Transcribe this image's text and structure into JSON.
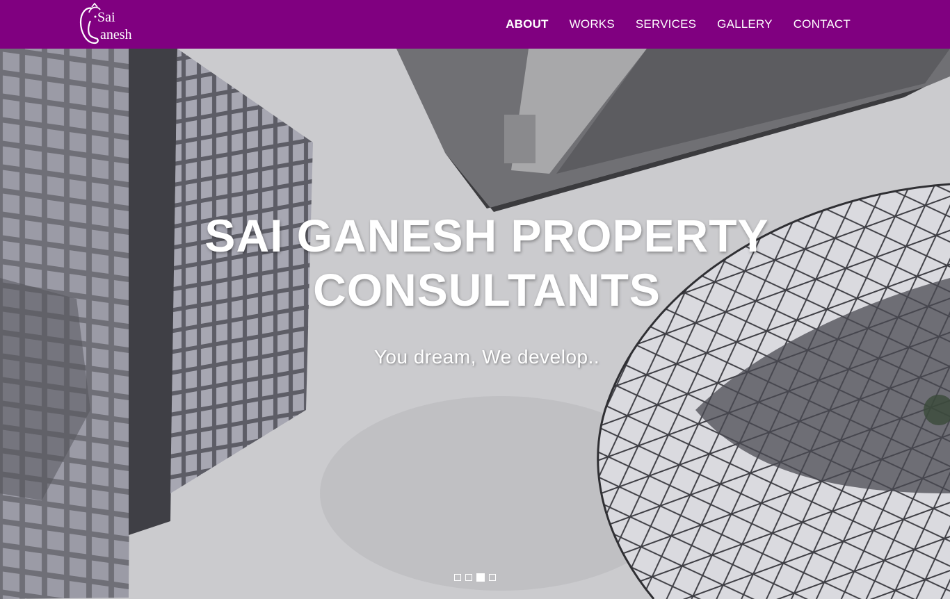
{
  "brand": {
    "logo_line1": "Sai",
    "logo_line2": "anesh",
    "color": "#800080"
  },
  "nav": {
    "items": [
      {
        "label": "ABOUT",
        "active": true
      },
      {
        "label": "WORKS",
        "active": false
      },
      {
        "label": "SERVICES",
        "active": false
      },
      {
        "label": "GALLERY",
        "active": false
      },
      {
        "label": "CONTACT",
        "active": false
      }
    ]
  },
  "hero": {
    "title_line1": "SAI GANESH PROPERTY",
    "title_line2": "CONSULTANTS",
    "subtitle": "You dream, We develop..",
    "slides_count": 4,
    "active_slide": 3
  }
}
